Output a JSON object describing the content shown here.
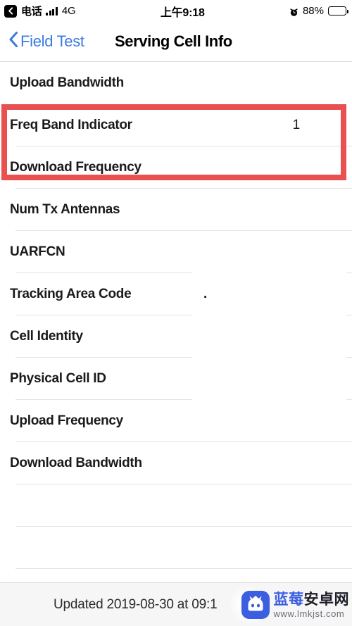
{
  "status_bar": {
    "back_badge_icon": "chevron-left-icon",
    "carrier": "电话",
    "signal_icon": "signal-bars-icon",
    "network": "4G",
    "time": "上午9:18",
    "alarm_icon": "alarm-clock-icon",
    "battery_percent": "88%",
    "battery_icon": "battery-full-icon"
  },
  "nav_bar": {
    "back_icon": "chevron-left-icon",
    "back_label": "Field Test",
    "title": "Serving Cell Info"
  },
  "list": {
    "rows": [
      {
        "label": "Upload Bandwidth",
        "value": "",
        "separator": "none"
      },
      {
        "label": "Freq Band Indicator",
        "value": "1",
        "separator": "full"
      },
      {
        "label": "Download Frequency",
        "value": "",
        "separator": "full"
      },
      {
        "label": "Num Tx Antennas",
        "value": "",
        "separator": "full"
      },
      {
        "label": "UARFCN",
        "value": "",
        "separator": "short"
      },
      {
        "label": "Tracking Area Code",
        "value": ".",
        "separator": "short"
      },
      {
        "label": "Cell Identity",
        "value": "",
        "separator": "short"
      },
      {
        "label": "Physical Cell ID",
        "value": "",
        "separator": "short"
      },
      {
        "label": "Upload Frequency",
        "value": "",
        "separator": "full"
      },
      {
        "label": "Download Bandwidth",
        "value": "",
        "separator": "full"
      },
      {
        "label": "",
        "value": "",
        "separator": "full"
      },
      {
        "label": "",
        "value": "",
        "separator": "full"
      },
      {
        "label": "",
        "value": "",
        "separator": "full"
      }
    ]
  },
  "highlight": {
    "color": "#e8514f",
    "encloses": [
      "Freq Band Indicator",
      "Download Frequency"
    ]
  },
  "bottom_bar": {
    "updated_text": "Updated 2019-08-30 at 09:1"
  },
  "watermark": {
    "icon": "android-robot-icon",
    "brand_blue": "蓝莓",
    "brand_dark": "安卓网",
    "url": "www.lmkjst.com",
    "accent_color": "#3b5fe0"
  }
}
